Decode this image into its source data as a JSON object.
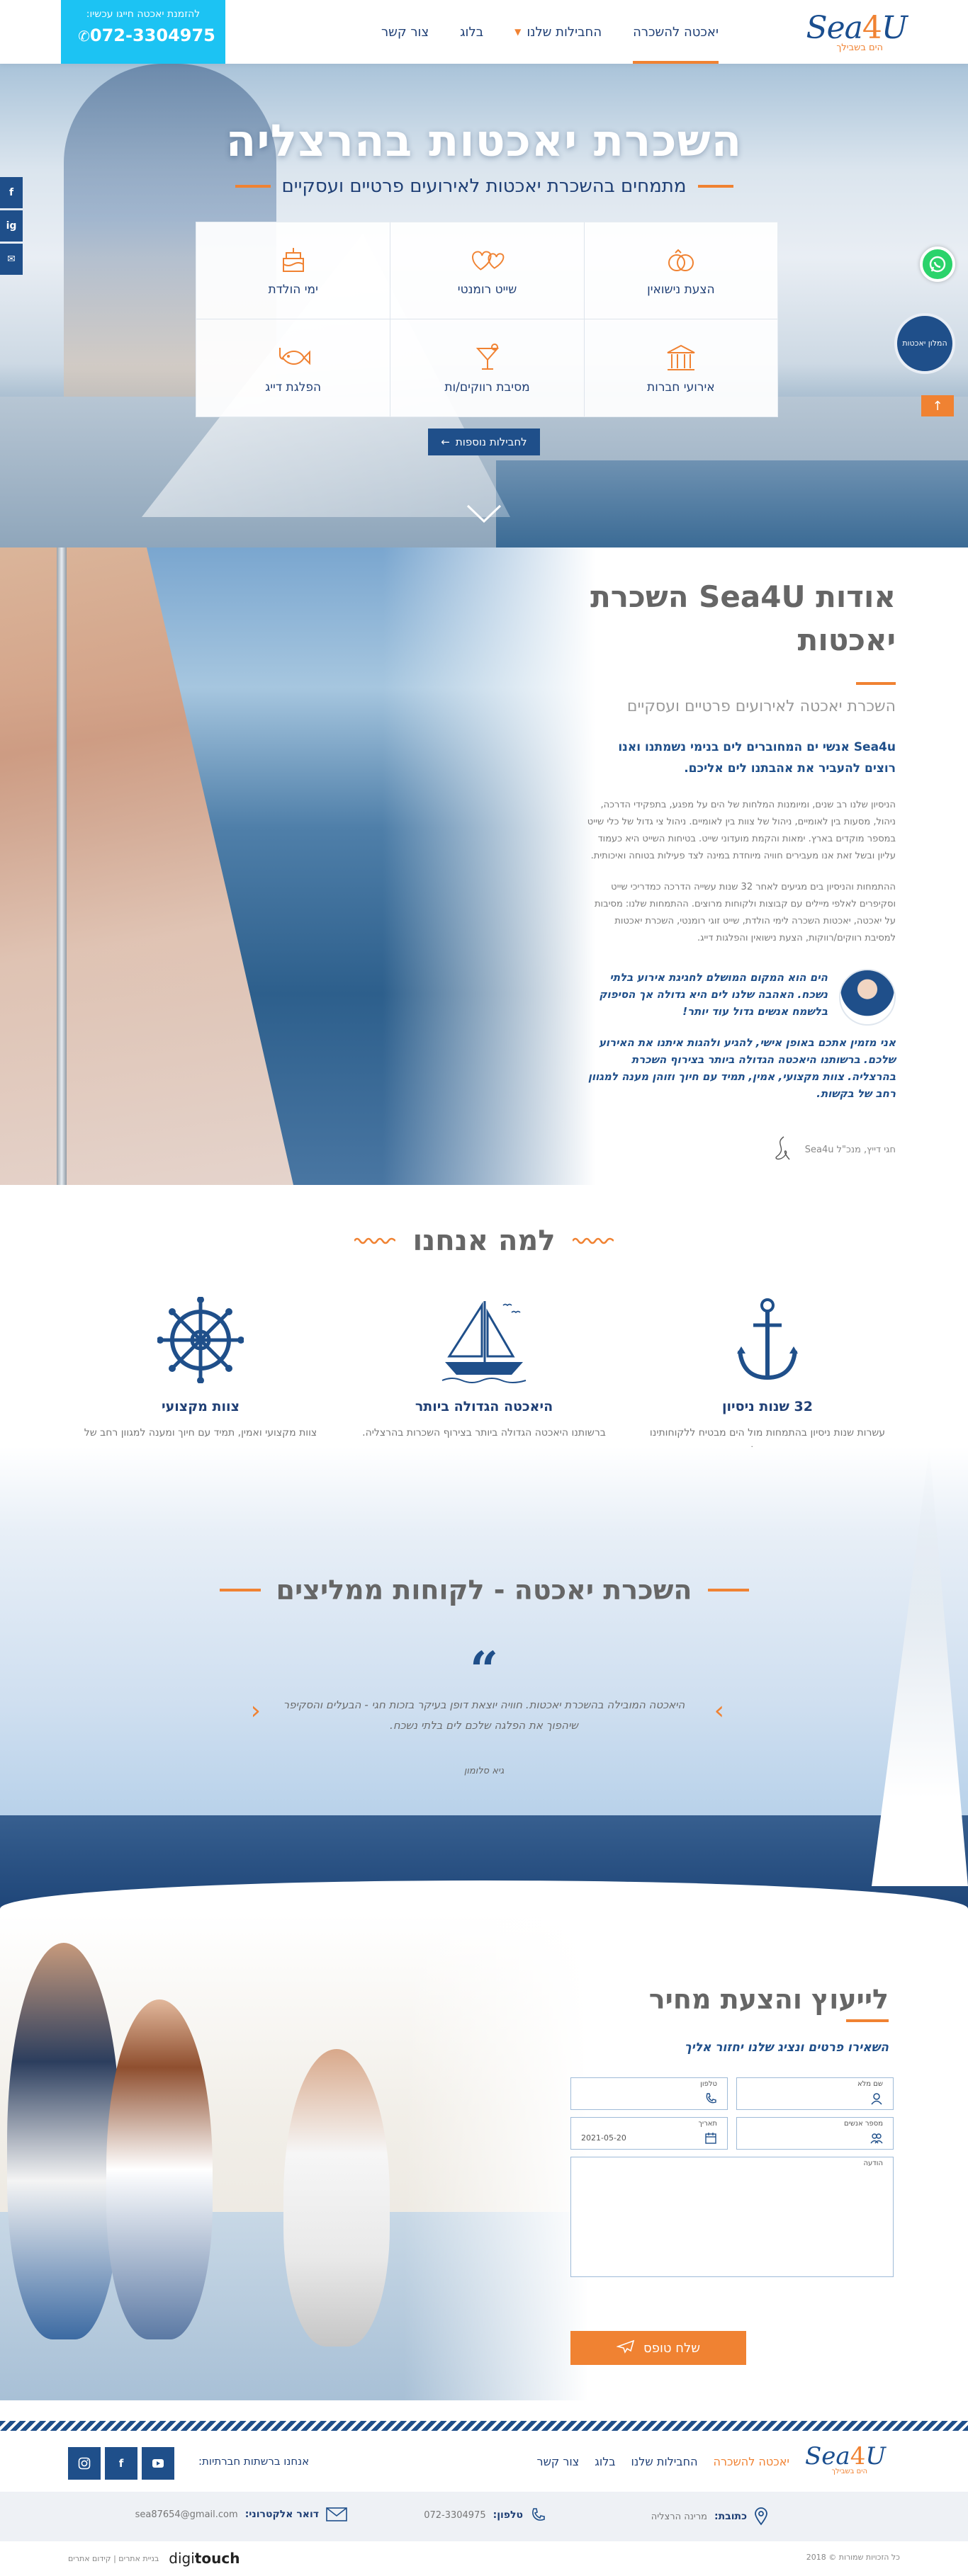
{
  "header": {
    "logo_main": "Sea",
    "logo_four": "4",
    "logo_u": "U",
    "logo_sub": "הים בשבילך",
    "nav": [
      {
        "label": "יאכטה להשכרה"
      },
      {
        "label": "החבילות שלנו"
      },
      {
        "label": "בלוג"
      },
      {
        "label": "צור קשר"
      }
    ],
    "call_label": "להזמנת יאכטה חייגו עכשיו:",
    "call_phone": "072-3304975"
  },
  "hero": {
    "title": "השכרת יאכטות בהרצליה",
    "subtitle": "מתמחים בהשכרת יאכטות לאירועים פרטיים ועסקיים",
    "tiles": [
      {
        "label": "הצעת נישואין",
        "icon": "rings-icon"
      },
      {
        "label": "שייט רומנטי",
        "icon": "hearts-icon"
      },
      {
        "label": "ימי הולדת",
        "icon": "cake-icon"
      },
      {
        "label": "אירועי חברות",
        "icon": "building-icon"
      },
      {
        "label": "מסיבת רווקים/ות",
        "icon": "cocktail-icon"
      },
      {
        "label": "הפלגת דייג",
        "icon": "fish-icon"
      }
    ],
    "more_button": "לחבילות נוספות",
    "badge_text": "המלון יאכטות"
  },
  "social_side": [
    "f",
    "ig",
    "✉"
  ],
  "about": {
    "title": "אודות Sea4U השכרת יאכטות",
    "subtitle": "השכרת יאכטה לאירועים פרטיים ועסקיים",
    "lead": "Sea4u אנשי ים המחוברים לים בנימי נשמתנו ואנו רוצים להעביר את אהבתנו לים אליכם.",
    "p1": "הניסיון שלנו רב שנים, ומיומנות המלחות של הים על מפגע, בתפקידי הדרכה, ניהול, מסעות בין לאומיים, ניהול של צוות בין לאומיים. ניהול צי גדול של כלי שייט במספר מוקדים בארץ. ימאות והקמת מועדוני שייט. בטיחות השייט היא כעמוד עליון ובשל זאת אנו מעבירים חוויה מיוחדת במינה לצד פעילות בטוחה ואיכותית.",
    "p2": "ההתמחות והניסיון בים מגיעים לאחר 32 שנות עשייה הדרכה כמדריכי שייט וסקיפרים לאלפי מיילים עם קבוצות ולקוחות מרוצים. ההתמחות שלנו: מסיבות על יאכטה, יאכטות השכרה לימי הולדת, שייט זוגי רומנטי, השכרת יאכטות למסיבת רווקים/רווקות, הצעת נישואין והפלגות דייג.",
    "quote1": "הים הוא המקום המושלם לחגיגת אירוע בלתי נשכח. האהבה שלנו לים היא גדולה אך הסיפוק בלשמח אנשים גדול עוד יותר!",
    "quote2": "אני מזמין אתכם באופן אישי, להגיע ולהגות איתנו את האירוע שלכם. ברשותנו היאכטה הגדולה ביותר בצירוף השכרת בהרצליה. צוות מקצועי, אמין, תמיד עם חיוך וזוהן מענה למגוון רחב של בקשות.",
    "signature": "חגי דייץ, מנכ\"ל Sea4u"
  },
  "why": {
    "title": "למה אנחנו",
    "features": [
      {
        "icon": "anchor-icon",
        "title": "32 שנות ניסיון",
        "desc": "עשרות שנות ניסיון בהתמחות מול הים מבטיח ללקוחותינו חוויה מושלמת"
      },
      {
        "icon": "sailboat-icon",
        "title": "היאכטה הגדולה ביותר",
        "desc": "ברשותנו היאכטה הגדולה ביותר בצירוף השכרות בהרצליה."
      },
      {
        "icon": "helm-icon",
        "title": "צוות מקצועי",
        "desc": "צוות מקצועי ואמין, תמיד עם חיוך ומענה למגוון רחב של אפשרויות"
      }
    ]
  },
  "testimonials": {
    "title": "השכרת יאכטה - לקוחות ממליצים",
    "text": "היאכטה המובילה בהשכרת יאכטות. חוויה יוצאת דופן בעיקר בזכות חגי - הבעלים והסקיפר שיהפוך את הפלגה שלכם לים בלתי נשכח.",
    "name": "גיא סלומון"
  },
  "contact": {
    "title": "לייעוץ והצעת מחיר",
    "subtitle": "השאירו פרטים ונציג שלנו יחזור אליך",
    "fields": [
      {
        "label": "שם מלא",
        "value": ""
      },
      {
        "label": "טלפון",
        "value": ""
      },
      {
        "label": "מספר אנשים",
        "value": ""
      },
      {
        "label": "תאריך",
        "value": "2021-05-20"
      },
      {
        "label": "הודעה",
        "value": ""
      }
    ],
    "submit": "שלח טופס"
  },
  "footer": {
    "logo_main": "Sea",
    "logo_four": "4",
    "logo_u": "U",
    "logo_sub": "הים בשבילך",
    "nav": [
      "יאכטה להשכרה",
      "החבילות שלנו",
      "בלוג",
      "צור קשר"
    ],
    "social_label": "אנחנו ברשתות חברתיות:",
    "social": [
      "ig",
      "f",
      "yt"
    ],
    "address_label": "כתובת:",
    "address": "מרינה הרצליה",
    "phone_label": "טלפון:",
    "phone": "072-3304975",
    "email_label": "דואר אלקטרוני:",
    "email": "sea87654@gmail.com",
    "copyright": "כל הזכויות שמורות © 2018",
    "credit_logo": "digi",
    "credit_logo2": "touch",
    "credit_links": "בניית אתרים | קידום אתרים"
  },
  "colors": {
    "brand_blue": "#1f4f8a",
    "accent_orange": "#f08232",
    "call_cyan": "#1cc3f3",
    "whatsapp_green": "#2bd36b"
  }
}
